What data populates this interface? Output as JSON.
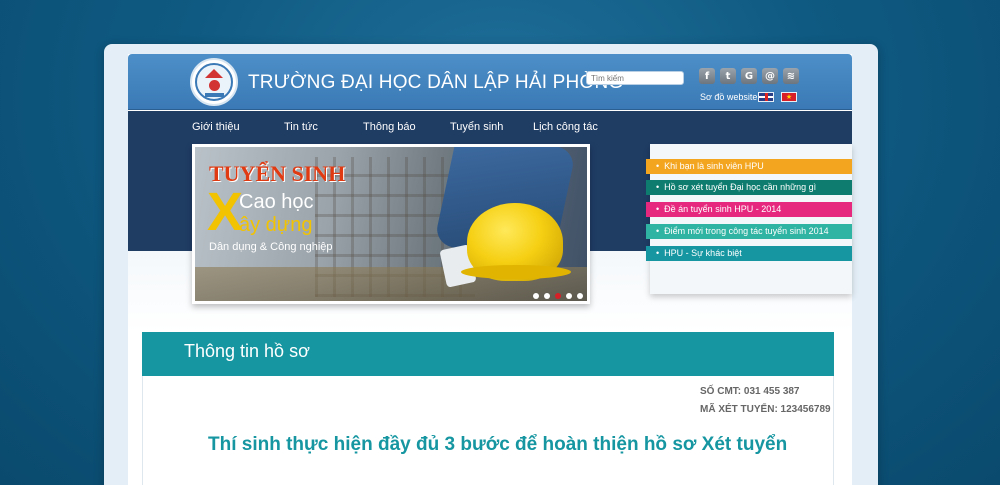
{
  "header": {
    "site_title": "TRƯỜNG ĐẠI HỌC DÂN LẬP HẢI PHÒNG",
    "search_placeholder": "Tìm kiếm",
    "sitemap": "Sơ đồ website",
    "social_icons": [
      {
        "icon": "facebook-icon",
        "glyph": "f"
      },
      {
        "icon": "twitter-icon",
        "glyph": "t"
      },
      {
        "icon": "google-icon",
        "glyph": "G"
      },
      {
        "icon": "email-icon",
        "glyph": "@"
      },
      {
        "icon": "rss-icon",
        "glyph": "≋"
      }
    ]
  },
  "nav": {
    "items": [
      "Giới thiệu",
      "Tin tức",
      "Thông báo",
      "Tuyển sinh",
      "Lịch công tác"
    ]
  },
  "banner": {
    "line1": "TUYỂN SINH",
    "big_letter": "X",
    "line2": "Cao học",
    "line3": "ây dựng",
    "line4": "Dân dụng & Công nghiệp",
    "slides": 5,
    "active_slide": 3
  },
  "sidebar": {
    "items": [
      {
        "label": "Khi bạn là sinh viên HPU",
        "color": "#f3a51f"
      },
      {
        "label": "Hồ sơ xét tuyển Đại học cần những gì",
        "color": "#0e7d6f"
      },
      {
        "label": "Đề án tuyển sinh HPU - 2014",
        "color": "#e7287f"
      },
      {
        "label": "Điểm mới trong công tác tuyển sinh 2014",
        "color": "#2fb3a2"
      },
      {
        "label": "HPU - Sự khác biệt",
        "color": "#1596a1"
      }
    ]
  },
  "content": {
    "title": "Thông tin hồ sơ",
    "id_number": "SỐ CMT: 031 455 387",
    "admission_code": "MÃ XÉT TUYỂN: 123456789",
    "headline": "Thí sinh thực hiện đầy đủ 3 bước để hoàn thiện hồ sơ Xét tuyển"
  },
  "colors": {
    "header_blue": "#3a79b5",
    "nav_dark": "#1f3c63",
    "teal": "#1596a1"
  }
}
